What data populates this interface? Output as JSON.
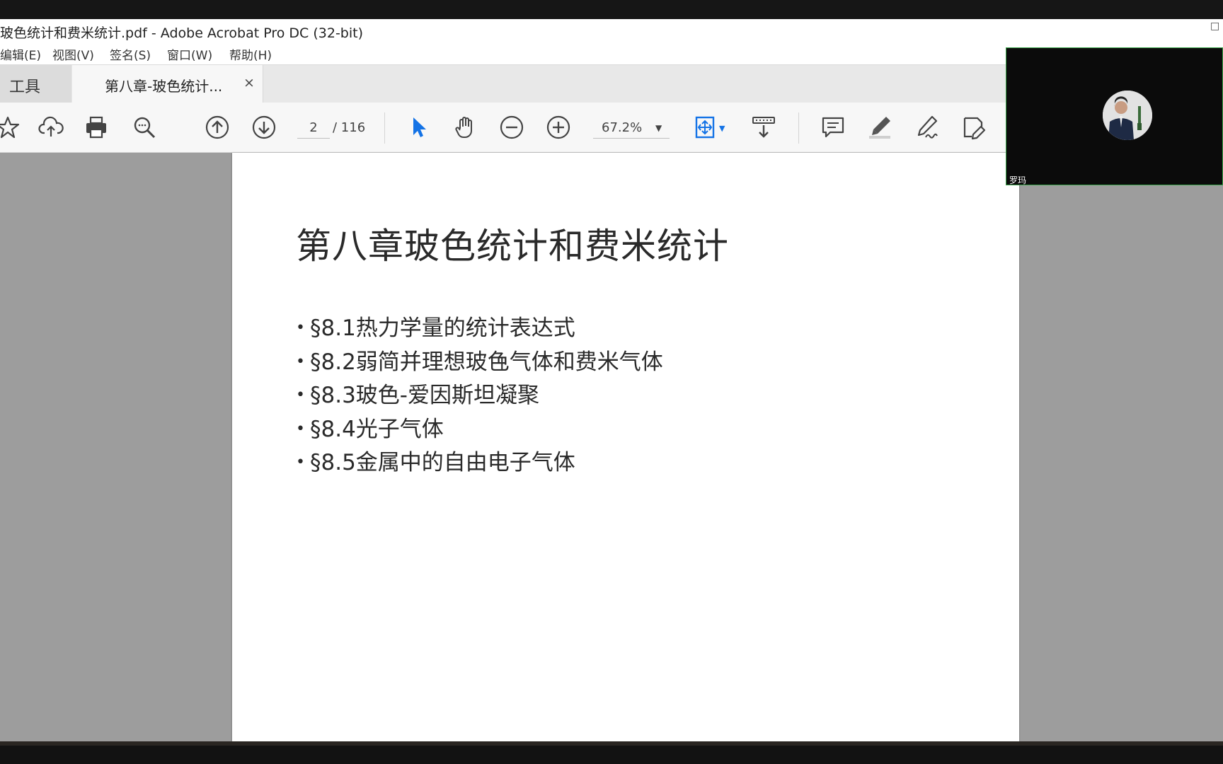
{
  "window": {
    "title": "玻色统计和费米统计.pdf - Adobe Acrobat Pro DC (32-bit)"
  },
  "menu": {
    "items": [
      "编辑(E)",
      "视图(V)",
      "签名(S)",
      "窗口(W)",
      "帮助(H)"
    ]
  },
  "tabs": {
    "tools_label": "工具",
    "document_label": "第八章-玻色统计...",
    "close_glyph": "×"
  },
  "toolbar": {
    "page_current": "2",
    "page_total": "/ 116",
    "zoom": "67.2%",
    "zoom_caret": "▼",
    "icons": [
      "bookmark-star-icon",
      "upload-cloud-icon",
      "print-icon",
      "search-zoom-icon",
      "previous-page-icon",
      "next-page-icon",
      "select-arrow-icon",
      "hand-tool-icon",
      "zoom-out-icon",
      "zoom-in-icon",
      "fit-page-icon",
      "read-mode-icon",
      "comment-icon",
      "highlight-icon",
      "sign-icon",
      "edit-pdf-icon"
    ],
    "accent_color": "#1473e6"
  },
  "document": {
    "heading": "第八章玻色统计和费米统计",
    "bullet": "•",
    "items": [
      "§8.1热力学量的统计表达式",
      "§8.2弱简并理想玻色气体和费米气体",
      "§8.3玻色-爱因斯坦凝聚",
      "§8.4光子气体",
      "§8.5金属中的自由电子气体"
    ]
  },
  "video": {
    "participant_name": "罗玛",
    "border_color": "#3aa54a"
  }
}
